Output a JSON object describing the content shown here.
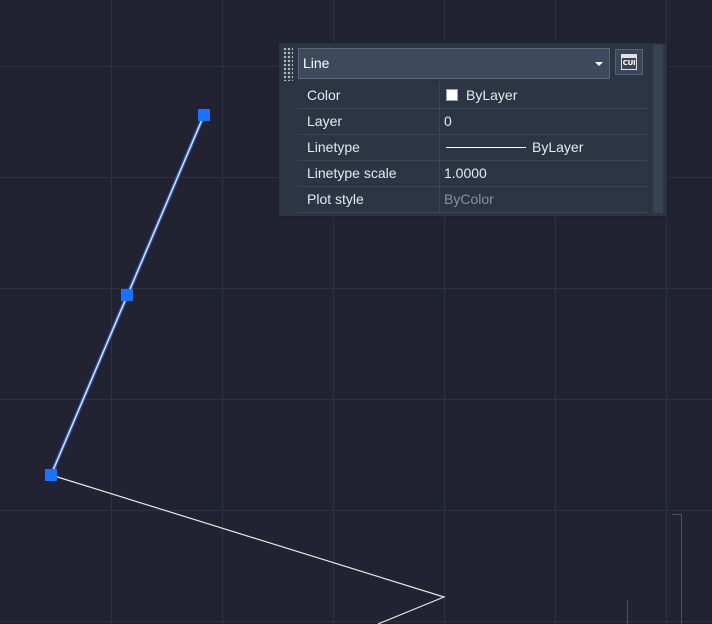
{
  "quick_properties": {
    "object_type": "Line",
    "rows": [
      {
        "label": "Color",
        "value": "ByLayer",
        "swatch_color": "#ffffff"
      },
      {
        "label": "Layer",
        "value": "0"
      },
      {
        "label": "Linetype",
        "value": "ByLayer"
      },
      {
        "label": "Linetype scale",
        "value": "1.0000"
      },
      {
        "label": "Plot style",
        "value": "ByColor"
      }
    ],
    "cui_button_label": "CUI"
  },
  "colors": {
    "background": "#212332",
    "grid": "#2d3443",
    "selected_line": "#d7e3ff",
    "selected_glow": "#3c7bff",
    "grip": "#1a73ff",
    "line": "#e8e8e8"
  },
  "icons": {
    "grip": "grip-dots-icon",
    "dropdown": "chevron-down-icon",
    "cui": "cui-window-icon"
  }
}
